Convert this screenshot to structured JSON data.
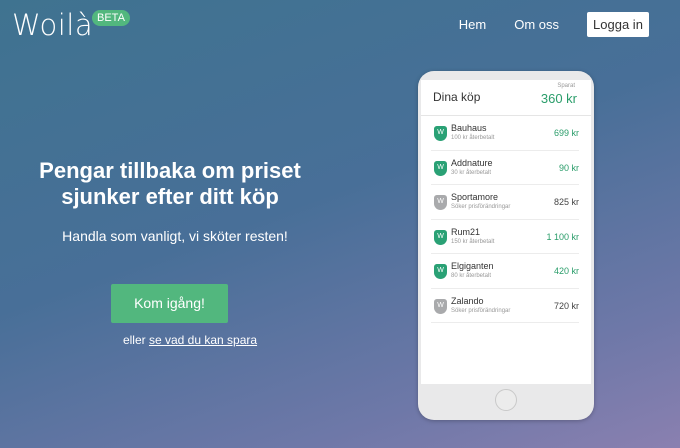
{
  "brand": {
    "name": "Woilà",
    "badge": "BETA"
  },
  "nav": {
    "home": "Hem",
    "about": "Om oss",
    "login": "Logga in"
  },
  "hero": {
    "title": "Pengar tillbaka om priset sjunker efter ditt köp",
    "subtitle": "Handla som vanligt, vi sköter resten!",
    "cta": "Kom igång!",
    "alt_prefix": "eller",
    "alt_link": "se vad du kan spara"
  },
  "phone": {
    "title": "Dina köp",
    "saved_label": "Sparat",
    "saved_value": "360 kr",
    "purchases": [
      {
        "name": "Bauhaus",
        "sub": "100 kr återbetalt",
        "amount": "699 kr",
        "refunded": true,
        "icon": "shield-w-green-icon"
      },
      {
        "name": "Addnature",
        "sub": "30 kr återbetalt",
        "amount": "90 kr",
        "refunded": true,
        "icon": "shield-w-green-icon"
      },
      {
        "name": "Sportamore",
        "sub": "Söker prisförändringar",
        "amount": "825 kr",
        "refunded": false,
        "icon": "shield-w-grey-icon"
      },
      {
        "name": "Rum21",
        "sub": "150 kr återbetalt",
        "amount": "1 100 kr",
        "refunded": true,
        "icon": "shield-w-green-icon"
      },
      {
        "name": "Elgiganten",
        "sub": "80 kr återbetalt",
        "amount": "420 kr",
        "refunded": true,
        "icon": "shield-w-green-icon"
      },
      {
        "name": "Zalando",
        "sub": "Söker prisförändringar",
        "amount": "720 kr",
        "refunded": false,
        "icon": "shield-w-grey-icon"
      }
    ],
    "shield_letter": "W"
  },
  "colors": {
    "accent": "#52b77e",
    "amount_green": "#2a9d6a",
    "shield_green": "#2aa175",
    "shield_grey": "#a9aaac"
  }
}
